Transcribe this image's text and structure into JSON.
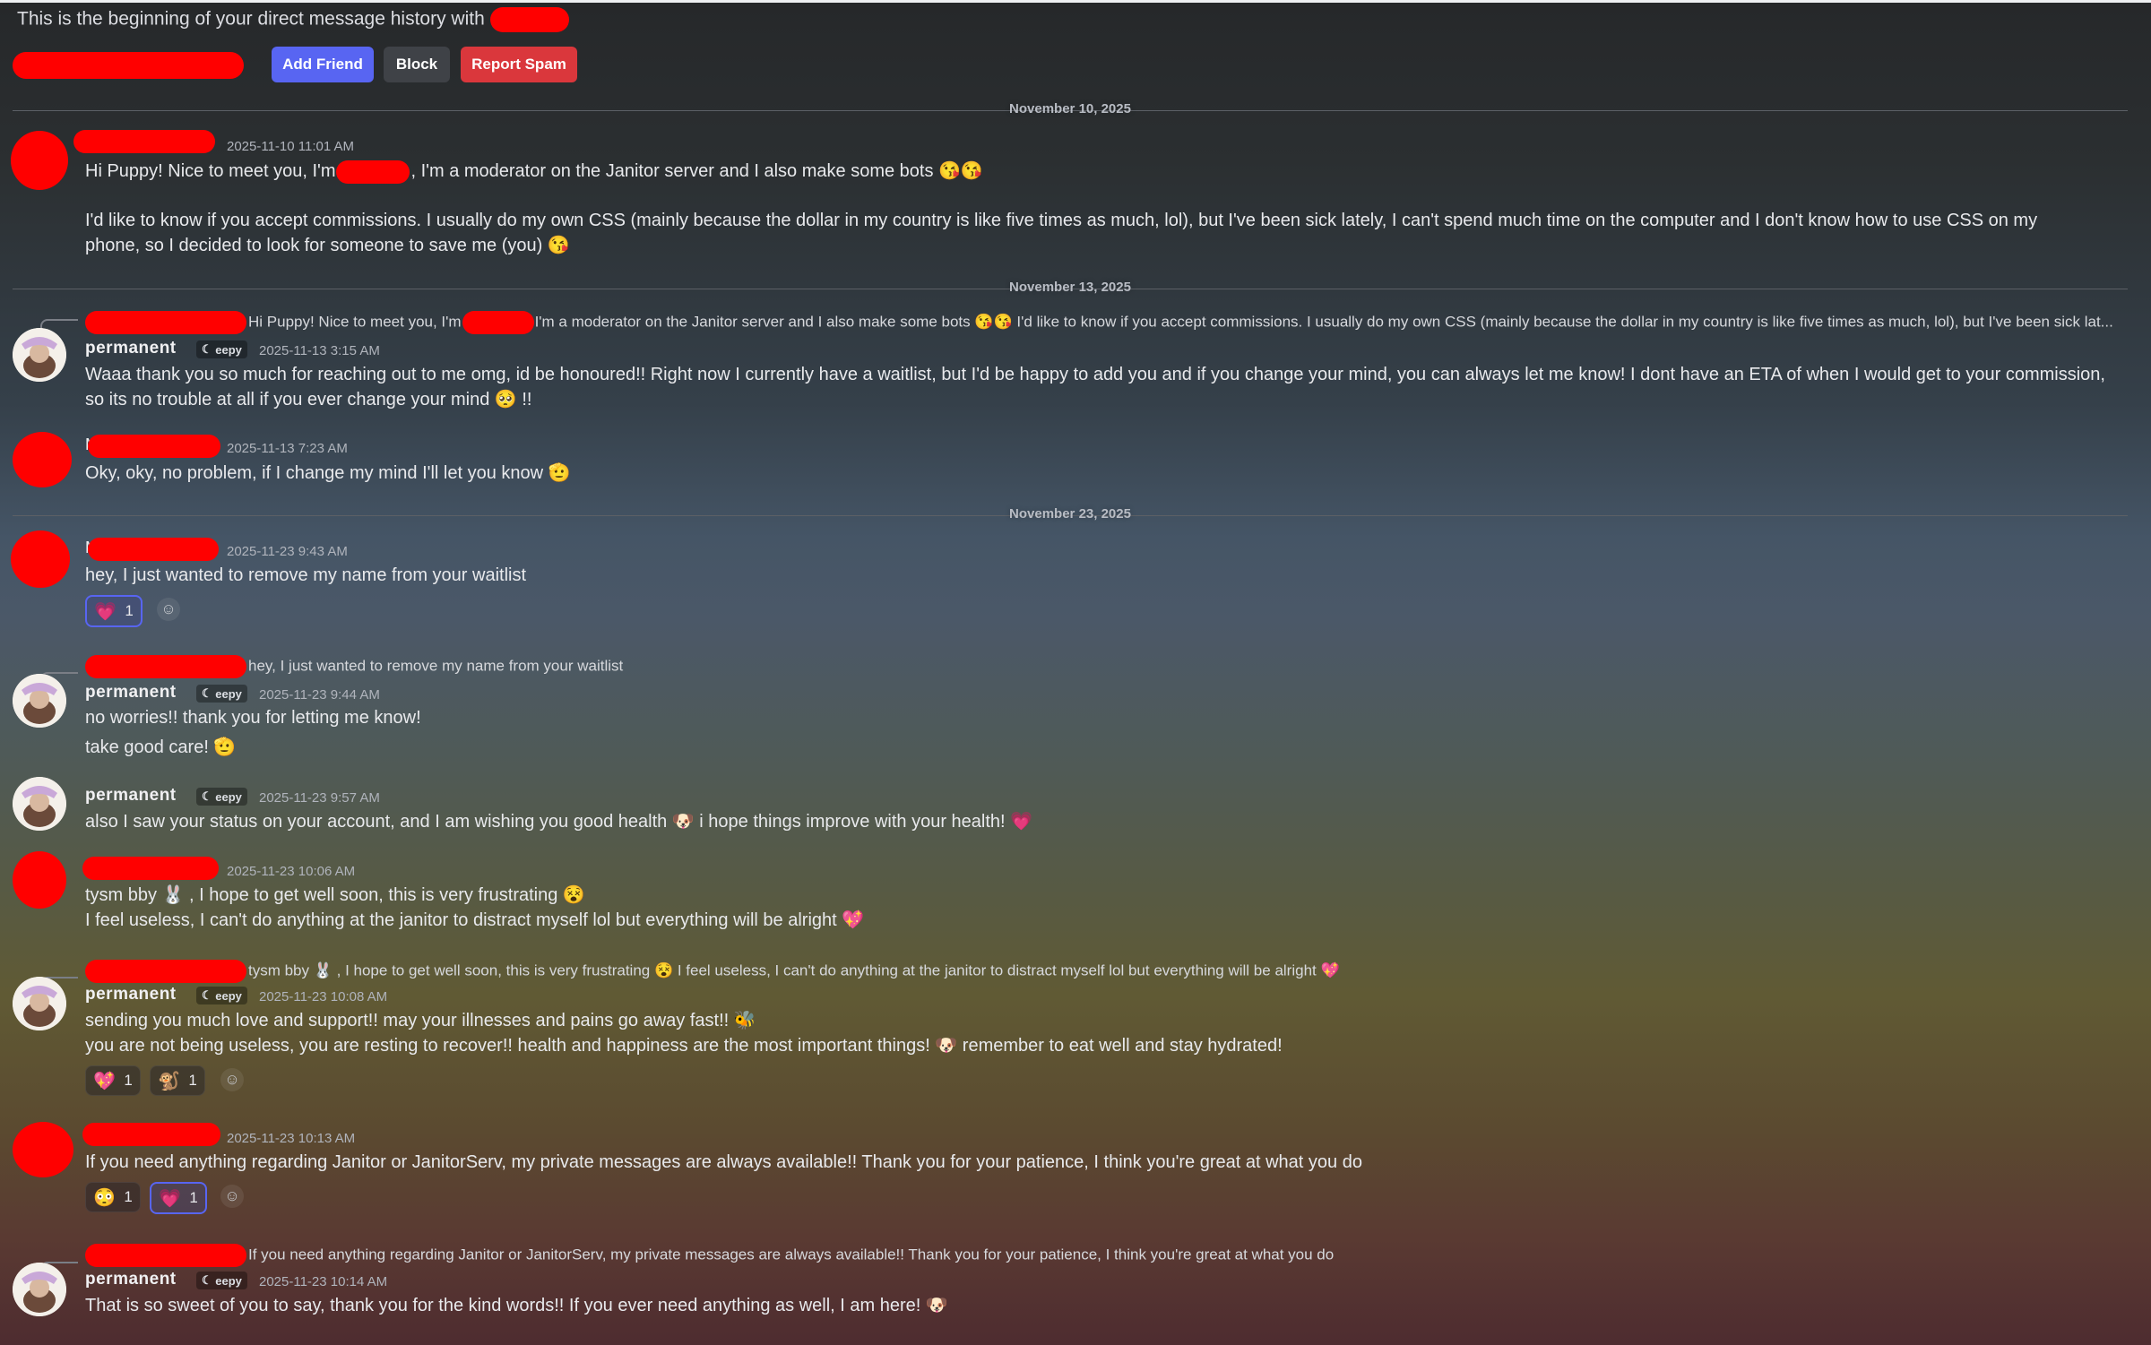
{
  "header": {
    "intro": "This is the beginning of your direct message history with",
    "buttons": {
      "add_friend": "Add Friend",
      "block": "Block",
      "report_spam": "Report Spam"
    }
  },
  "dates": [
    "November 10, 2025",
    "November 13, 2025",
    "November 23, 2025"
  ],
  "tag_label": "eepy",
  "tag_icon": "moon-icon",
  "perm_name": "permanent",
  "colors": {
    "accent": "#5865f2",
    "danger": "#da373c",
    "redaction": "#ff0000"
  },
  "m1": {
    "ts": "2025-11-10 11:01 AM",
    "p1a": "Hi Puppy! Nice to meet you, I'm",
    "p1b": ", I'm a moderator on the Janitor server and I also make some bots 😘😘",
    "p2": "I'd like to know if you accept commissions. I usually do my own CSS (mainly because the dollar in my country is like five times as much, lol), but I've been sick lately, I can't spend much time on the computer and I don't know how to use CSS on my phone, so I decided to look for someone to save me (you) 😘"
  },
  "m2": {
    "reply_a": "Hi Puppy! Nice to meet you, I'm",
    "reply_b": "I'm a moderator on the Janitor server and I also make some bots 😘😘  I'd like to know if you accept commissions. I usually do my own CSS (mainly because the dollar in my country is like five times as much, lol), but I've been sick lat...",
    "ts": "2025-11-13 3:15 AM",
    "text": "Waaa thank you so much for reaching out to me omg, id be honoured!! Right now I currently have a waitlist, but I'd be happy to add you and if you change your mind, you can always let me know! I dont have an ETA of when I would get to your commission, so its no trouble at all if you ever change your mind 🥺 !!"
  },
  "m3": {
    "name_initial": "M",
    "ts": "2025-11-13 7:23 AM",
    "text": "Oky, oky, no problem, if I change my mind I'll let you know 🫡"
  },
  "m4": {
    "name_initial": "M",
    "ts": "2025-11-23 9:43 AM",
    "text": "hey, I just wanted to remove my name from your waitlist",
    "reactions": [
      {
        "emoji": "💗",
        "count": "1"
      }
    ]
  },
  "m5": {
    "reply": "hey, I just wanted to remove my name from your waitlist",
    "ts": "2025-11-23 9:44 AM",
    "line1": "no worries!! thank you for letting me know!",
    "line2": "take good care! 🫡"
  },
  "m6": {
    "ts": "2025-11-23 9:57 AM",
    "text": "also I saw your status on your account, and I am wishing you good health 🐶  i hope things improve with your health! 💗"
  },
  "m7": {
    "ts": "2025-11-23 10:06 AM",
    "line1": "tysm bby 🐰 , I hope to get well soon, this is very frustrating 😵",
    "line2": "I feel useless, I can't do anything at the janitor to distract myself lol but everything will be alright 💖"
  },
  "m8": {
    "reply": "tysm bby 🐰 , I hope to get well soon, this is very frustrating 😵  I feel useless, I can't do anything at the janitor to distract myself lol but everything will be alright 💖",
    "ts": "2025-11-23 10:08 AM",
    "line1": "sending you much love and support!! may your illnesses and pains go away fast!! 🐝",
    "line2": "you are not being useless, you are resting to recover!! health and happiness are the most important things! 🐶  remember to eat well and stay hydrated!",
    "reactions": [
      {
        "emoji": "💖",
        "count": "1"
      },
      {
        "emoji": "🐒",
        "count": "1"
      }
    ]
  },
  "m9": {
    "ts": "2025-11-23 10:13 AM",
    "text": "If you need anything regarding Janitor or JanitorServ, my private messages are always available!! Thank you for your patience, I think you're great at what you do",
    "reactions": [
      {
        "emoji": "😳",
        "count": "1"
      },
      {
        "emoji": "💗",
        "count": "1"
      }
    ]
  },
  "m10": {
    "reply": "If you need anything regarding Janitor or JanitorServ, my private messages are always available!! Thank you for your patience, I think you're great at what you do",
    "ts": "2025-11-23 10:14 AM",
    "text": "That is so sweet of you to say, thank you for the kind words!! If you ever need anything as well, I am here! 🐶"
  }
}
